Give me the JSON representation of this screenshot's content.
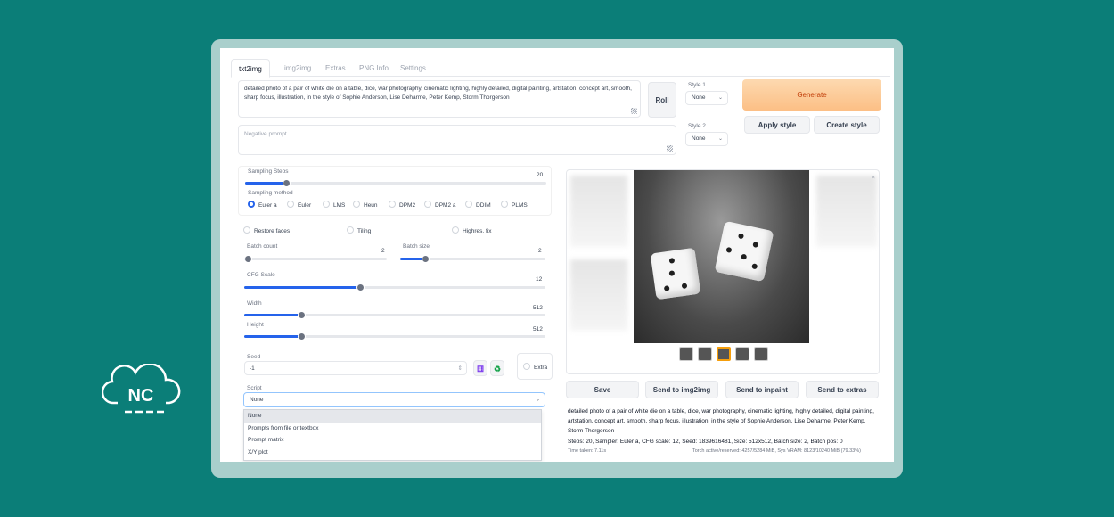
{
  "tabs": [
    "txt2img",
    "img2img",
    "Extras",
    "PNG Info",
    "Settings"
  ],
  "prompt": "detailed photo of a pair of white die on a table, dice, war photography, cinematic lighting, highly detailed, digital painting, artstation, concept art, smooth, sharp focus, illustration, in the style of Sophie Anderson, Lise Deharme, Peter Kemp, Storm Thorgerson",
  "negative_placeholder": "Negative prompt",
  "roll_label": "Roll",
  "style1_label": "Style 1",
  "style1_value": "None",
  "style2_label": "Style 2",
  "style2_value": "None",
  "generate_label": "Generate",
  "apply_style_label": "Apply style",
  "create_style_label": "Create style",
  "sampling_steps_label": "Sampling Steps",
  "sampling_steps_value": "20",
  "sampling_method_label": "Sampling method",
  "sampling_methods": [
    "Euler a",
    "Euler",
    "LMS",
    "Heun",
    "DPM2",
    "DPM2 a",
    "DDIM",
    "PLMS"
  ],
  "restore_faces_label": "Restore faces",
  "tiling_label": "Tiling",
  "highres_label": "Highres. fix",
  "batch_count_label": "Batch count",
  "batch_count_value": "2",
  "batch_size_label": "Batch size",
  "batch_size_value": "2",
  "cfg_label": "CFG Scale",
  "cfg_value": "12",
  "width_label": "Width",
  "width_value": "512",
  "height_label": "Height",
  "height_value": "512",
  "seed_label": "Seed",
  "seed_value": "-1",
  "extra_label": "Extra",
  "script_label": "Script",
  "script_value": "None",
  "script_options": [
    "None",
    "Prompts from file or textbox",
    "Prompt matrix",
    "X/Y plot"
  ],
  "save_label": "Save",
  "send_img2img_label": "Send to img2img",
  "send_inpaint_label": "Send to inpaint",
  "send_extras_label": "Send to extras",
  "output_prompt": "detailed photo of a pair of white die on a table, dice, war photography, cinematic lighting, highly detailed, digital painting, artstation, concept art, smooth, sharp focus, illustration, in the style of Sophie Anderson, Lise Deharme, Peter Kemp, Storm Thorgerson",
  "output_params": "Steps: 20, Sampler: Euler a, CFG scale: 12, Seed: 1839616481, Size: 512x512, Batch size: 2, Batch pos: 0",
  "time_taken": "Time taken: 7.11s",
  "torch_info": "Torch active/reserved: 4257/5284 MiB, Sys VRAM: 8123/10240 MiB (79.33%)",
  "logo_text": "NC",
  "colors": {
    "background": "#0b7e78",
    "accent": "#2563eb",
    "generate": "#fcbf85"
  }
}
